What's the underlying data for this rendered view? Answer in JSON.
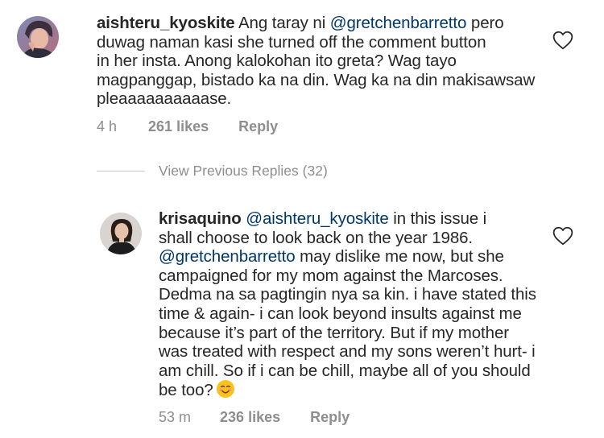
{
  "comments": [
    {
      "username": "aishteru_kyoskite",
      "lines": [
        [
          {
            "t": "Ang taray ni "
          },
          {
            "t": "@gretchenbarretto",
            "m": true
          },
          {
            "t": " pero"
          }
        ],
        [
          {
            "t": "duwag naman kasi she turned off the comment button"
          }
        ],
        [
          {
            "t": "in her insta. Anong kalokohan ito greta? Wag tayo"
          }
        ],
        [
          {
            "t": "magpanggap, bistado ka na din. Wag ka na din makisawsaw"
          }
        ],
        [
          {
            "t": "pleaaaaaaaaaase."
          }
        ]
      ],
      "time": "4 h",
      "likes": "261 likes",
      "reply": "Reply"
    },
    {
      "username": "krisaquino",
      "lines": [
        [
          {
            "t": "@aishteru_kyoskite",
            "m": true
          },
          {
            "t": " in this issue i"
          }
        ],
        [
          {
            "t": "shall choose to look back on the year 1986."
          }
        ],
        [
          {
            "t": "@gretchenbarretto",
            "m": true
          },
          {
            "t": " may dislike me now, but she"
          }
        ],
        [
          {
            "t": "campaigned for my mom against the Marcoses."
          }
        ],
        [
          {
            "t": "Dedma na sa pagtingin nya sa kin. i have stated this"
          }
        ],
        [
          {
            "t": "time & again- i can look beyond insults against me"
          }
        ],
        [
          {
            "t": "because it’s part of the territory. But if my mother"
          }
        ],
        [
          {
            "t": "was treated with respect and my sons weren’t hurt- i"
          }
        ],
        [
          {
            "t": "am chill. So if i can be chill, maybe all of you should"
          }
        ],
        [
          {
            "t": "be too?"
          }
        ]
      ],
      "emoji": "smiling-face-emoji",
      "time": "53 m",
      "likes": "236 likes",
      "reply": "Reply"
    }
  ],
  "view_previous": "View Previous Replies (32)",
  "icons": {
    "like": "heart-outline-icon"
  },
  "colors": {
    "text": "#262626",
    "mention": "#00376b",
    "meta": "#8e8e8e",
    "divider": "#c7c7c7"
  }
}
